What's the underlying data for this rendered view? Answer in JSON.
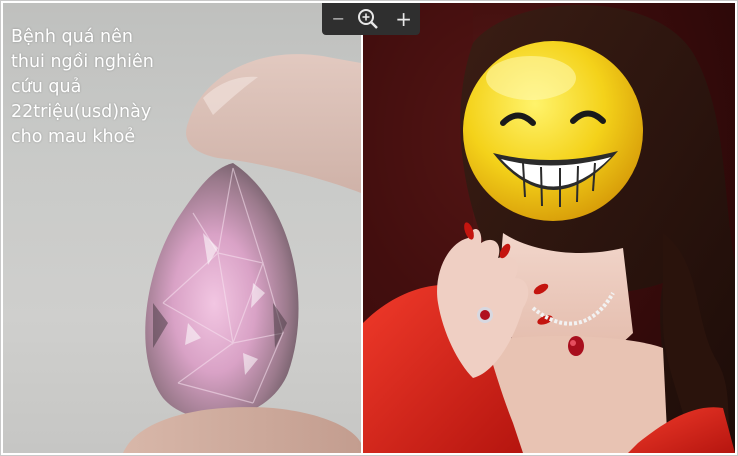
{
  "caption": {
    "lines": [
      "Bệnh quá nên",
      "thui ngồi nghiên",
      "cứu quả",
      "22triệu(usd)này",
      "cho mau khoẻ"
    ]
  },
  "zoom_controls": {
    "zoom_out_label": "−",
    "zoom_in_label": "+"
  },
  "colors": {
    "diamond": "#e6a9cf",
    "dress": "#e0241c",
    "emoji": "#f4d21a"
  }
}
